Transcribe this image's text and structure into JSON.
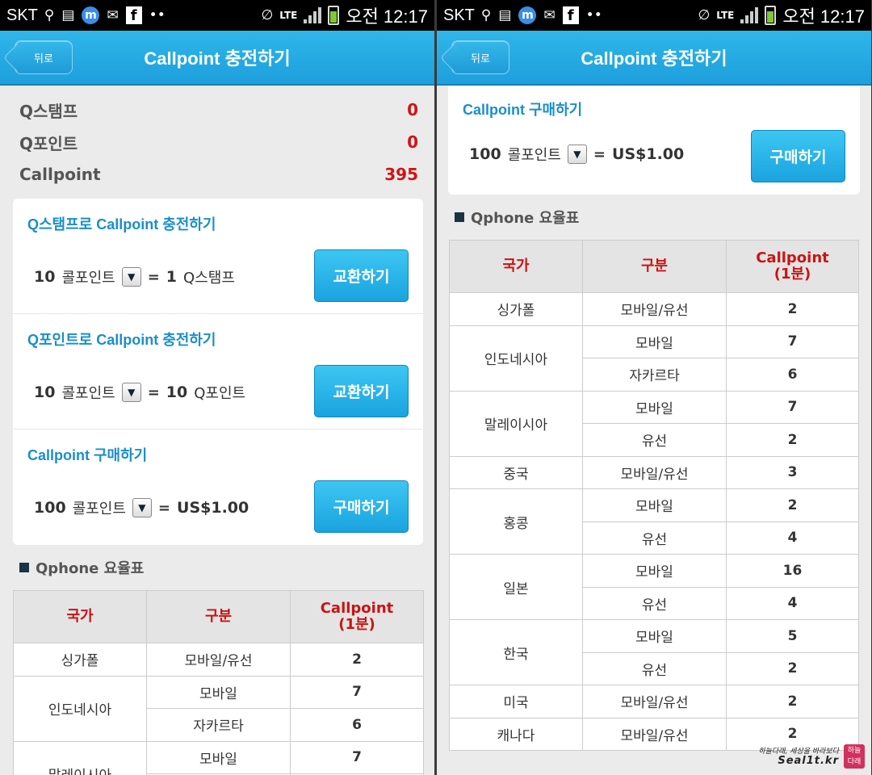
{
  "statusbar": {
    "carrier": "SKT",
    "lte": "LTE",
    "time": "오전 12:17",
    "icons": [
      "search-icon",
      "gallery-icon",
      "m-app-icon",
      "mail-icon",
      "facebook-icon",
      "dots-icon",
      "mute-icon",
      "lte-icon",
      "signal-icon",
      "battery-icon"
    ],
    "fb_glyph": "f",
    "m_glyph": "m"
  },
  "titlebar": {
    "back_label": "뒤로",
    "title": "Callpoint 충전하기",
    "color": "#1d9fdc"
  },
  "balances": [
    {
      "label": "Q스탬프",
      "value": "0"
    },
    {
      "label": "Q포인트",
      "value": "0"
    },
    {
      "label": "Callpoint",
      "value": "395"
    }
  ],
  "sections": [
    {
      "title": "Q스탬프로 Callpoint 충전하기",
      "qty": "10",
      "unit": "콜포인트",
      "eq": "=",
      "result_num": "1",
      "result_unit": "Q스탬프",
      "button": "교환하기"
    },
    {
      "title": "Q포인트로 Callpoint 충전하기",
      "qty": "10",
      "unit": "콜포인트",
      "eq": "=",
      "result_num": "10",
      "result_unit": "Q포인트",
      "button": "교환하기"
    },
    {
      "title": "Callpoint 구매하기",
      "qty": "100",
      "unit": "콜포인트",
      "eq": "=",
      "result_num": "US$1.00",
      "result_unit": "",
      "button": "구매하기"
    }
  ],
  "rates": {
    "heading": "Qphone 요율표",
    "headers": [
      "국가",
      "구분",
      "Callpoint",
      "(1분)"
    ],
    "rows": [
      {
        "country": "싱가폴",
        "type": "모바일/유선",
        "value": "2"
      },
      {
        "country": "인도네시아",
        "type": "모바일",
        "value": "7"
      },
      {
        "country": "",
        "type": "자카르타",
        "value": "6"
      },
      {
        "country": "말레이시아",
        "type": "모바일",
        "value": "7"
      },
      {
        "country": "",
        "type": "유선",
        "value": "2"
      },
      {
        "country": "중국",
        "type": "모바일/유선",
        "value": "3"
      },
      {
        "country": "홍콩",
        "type": "모바일",
        "value": "2"
      },
      {
        "country": "",
        "type": "유선",
        "value": "4"
      },
      {
        "country": "일본",
        "type": "모바일",
        "value": "16"
      },
      {
        "country": "",
        "type": "유선",
        "value": "4"
      },
      {
        "country": "한국",
        "type": "모바일",
        "value": "5"
      },
      {
        "country": "",
        "type": "유선",
        "value": "2"
      },
      {
        "country": "미국",
        "type": "모바일/유선",
        "value": "2"
      },
      {
        "country": "캐나다",
        "type": "모바일/유선",
        "value": "2"
      }
    ]
  },
  "watermark": {
    "line1": "하늘다래, 세상을 바라보다",
    "line2": "Seal1t.kr",
    "logo": "하늘 다래"
  },
  "select_arrow": "▼"
}
